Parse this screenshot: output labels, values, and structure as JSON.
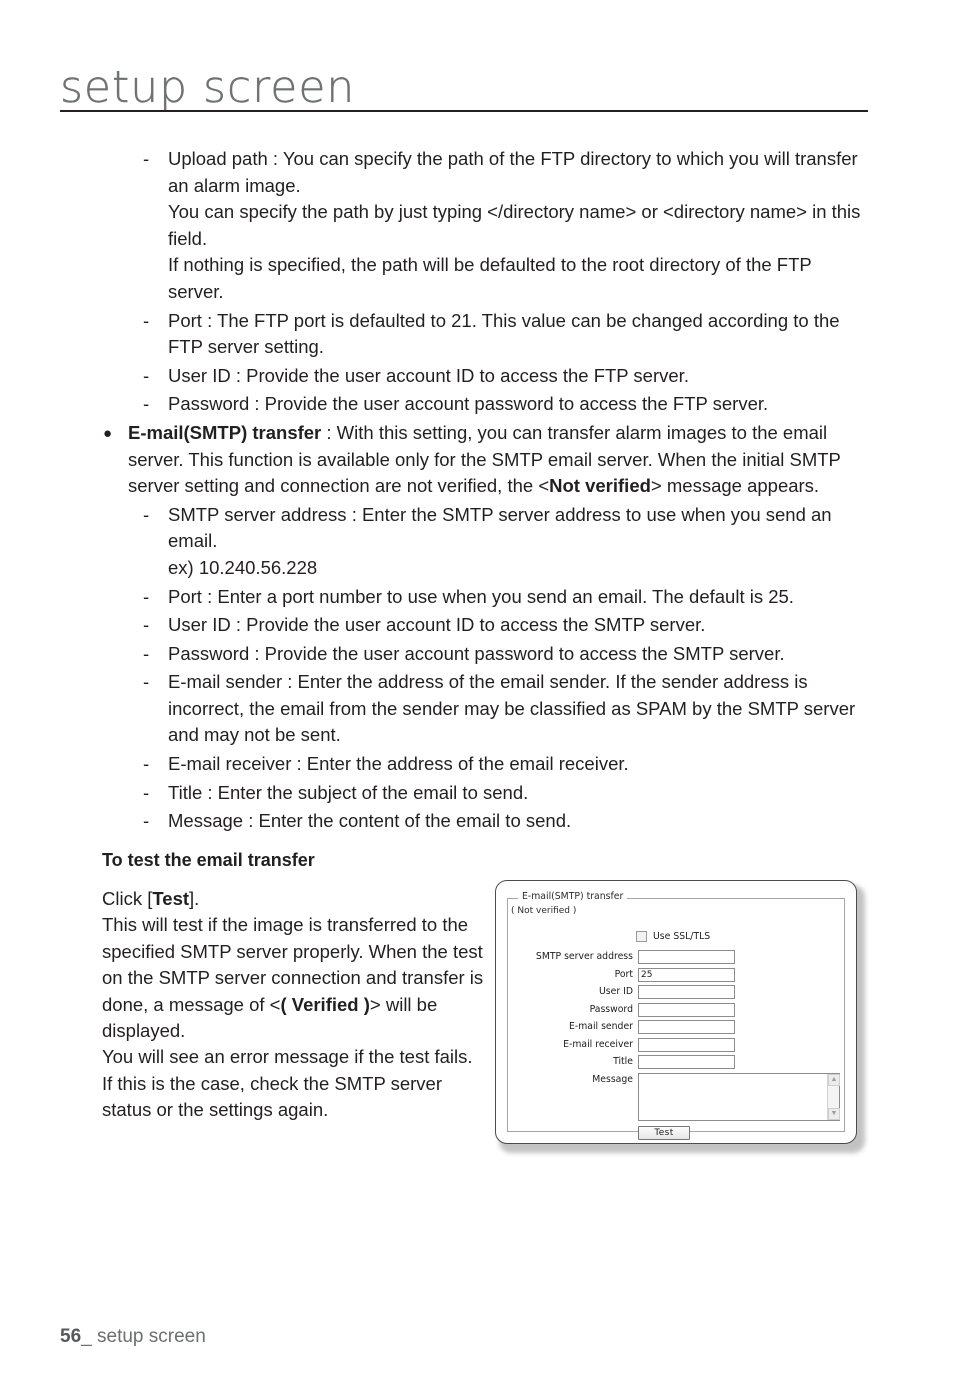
{
  "header": {
    "title": "setup screen"
  },
  "bullets": [
    {
      "marker": "-",
      "type": "dash",
      "lines": [
        "Upload path : You can specify the path of the FTP directory to which you will transfer an alarm image.",
        "You can specify the path by just typing </directory name> or <directory name> in this field.",
        "If nothing is specified, the path will be defaulted to the root directory of the FTP server."
      ]
    },
    {
      "marker": "-",
      "type": "dash",
      "lines": [
        "Port : The FTP port is defaulted to 21. This value can be changed according to the FTP server setting."
      ]
    },
    {
      "marker": "-",
      "type": "dash",
      "lines": [
        "User ID : Provide the user account ID to access the FTP server."
      ]
    },
    {
      "marker": "-",
      "type": "dash",
      "lines": [
        "Password : Provide the user account password to access the FTP server."
      ]
    }
  ],
  "smtp_bullet": {
    "marker": "●",
    "bold_lead": "E-mail(SMTP) transfer",
    "text_part1": " : With this setting, you can transfer alarm images to the email server. This function is available only for the SMTP email server. When the initial SMTP server setting and connection are not verified, the <",
    "bold_mid": "Not verified",
    "text_part2": "> message appears."
  },
  "smtp_subitems": [
    {
      "marker": "-",
      "lines": [
        "SMTP server address : Enter the SMTP server address to use when you send an email.",
        "ex) 10.240.56.228"
      ]
    },
    {
      "marker": "-",
      "lines": [
        "Port : Enter a port number to use when you send an email. The default is 25."
      ]
    },
    {
      "marker": "-",
      "lines": [
        "User ID : Provide the user account ID to access the SMTP server."
      ]
    },
    {
      "marker": "-",
      "lines": [
        "Password : Provide the user account password to access the SMTP server."
      ]
    },
    {
      "marker": "-",
      "lines": [
        "E-mail sender : Enter the address of the email sender. If the sender address is incorrect, the email from the sender may be classified as SPAM by the SMTP server and may not be sent."
      ]
    },
    {
      "marker": "-",
      "lines": [
        "E-mail receiver : Enter the address of the email receiver."
      ]
    },
    {
      "marker": "-",
      "lines": [
        "Title : Enter the subject of the email to send."
      ]
    },
    {
      "marker": "-",
      "lines": [
        "Message : Enter the content of the email to send."
      ]
    }
  ],
  "lower": {
    "heading": "To test the email transfer",
    "line1_pre": "Click [",
    "line1_bold": "Test",
    "line1_post": "].",
    "line2": "This will test if the image is transferred to the specified SMTP server properly. When the test on the SMTP server connection and transfer is done, a message of <",
    "line2_bold": "( Verified )",
    "line2_post": "> will be displayed.",
    "line3": "You will see an error message if the test fails.",
    "line4": "If this is the case, check the SMTP server status or the settings again."
  },
  "screenshot": {
    "legend": "E-mail(SMTP) transfer",
    "legend_sub": "( Not verified )",
    "ssl_checkbox_label": "Use SSL/TLS",
    "ssl_checked": false,
    "fields": [
      {
        "label": "SMTP server address",
        "value": "",
        "kind": "text"
      },
      {
        "label": "Port",
        "value": "25",
        "kind": "text"
      },
      {
        "label": "User ID",
        "value": "",
        "kind": "text"
      },
      {
        "label": "Password",
        "value": "",
        "kind": "text"
      },
      {
        "label": "E-mail sender",
        "value": "",
        "kind": "text"
      },
      {
        "label": "E-mail receiver",
        "value": "",
        "kind": "text"
      },
      {
        "label": "Title",
        "value": "",
        "kind": "text"
      },
      {
        "label": "Message",
        "value": "",
        "kind": "textarea"
      }
    ],
    "test_button": "Test",
    "scroll_up_icon": "▲",
    "scroll_down_icon": "▼"
  },
  "footer": {
    "page_number": "56",
    "separator": "_ ",
    "label": "setup screen"
  }
}
